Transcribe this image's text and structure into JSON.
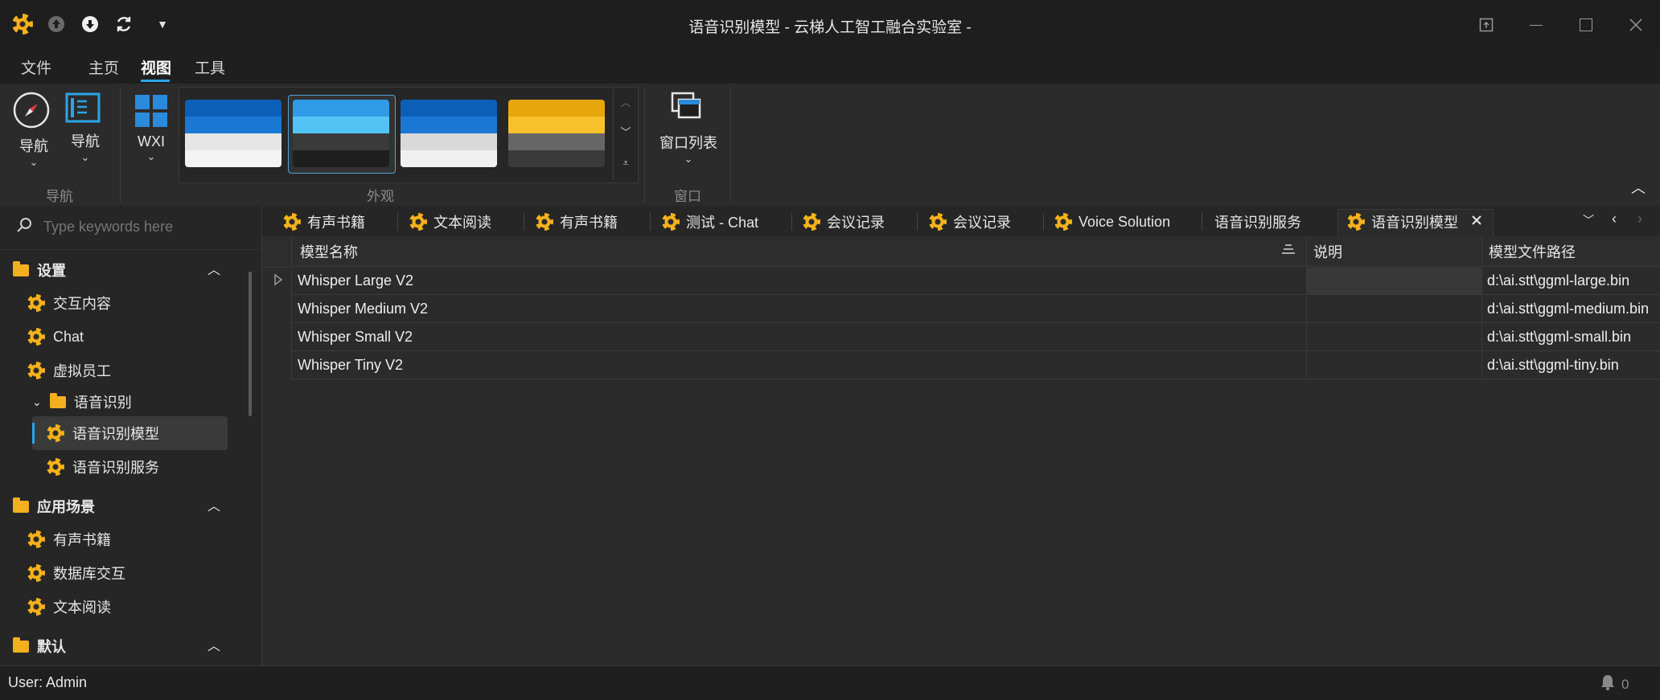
{
  "window": {
    "title": "语音识别模型 - 云梯人工智工融合实验室 -"
  },
  "menu": {
    "tabs": [
      "文件",
      "主页",
      "视图",
      "工具"
    ],
    "active": "视图"
  },
  "ribbon": {
    "nav_button_1": "导航",
    "nav_button_2": "导航",
    "group_nav": "导航",
    "wxi_label": "WXI",
    "group_appearance": "外观",
    "window_list_label": "窗口列表",
    "group_window": "窗口"
  },
  "themes": [
    {
      "colors": [
        "#0b5fb8",
        "#1a78d4",
        "#e6e6e6",
        "#f3f3f3"
      ]
    },
    {
      "colors": [
        "#2f9ae6",
        "#53c2f5",
        "#3a3a3a",
        "#1f1f1f"
      ]
    },
    {
      "colors": [
        "#0b5fb8",
        "#1a78d4",
        "#d9d9d9",
        "#f0f0f0"
      ]
    },
    {
      "colors": [
        "#e8a60d",
        "#f6c12a",
        "#666666",
        "#3a3a3a"
      ]
    }
  ],
  "search": {
    "placeholder": "Type keywords here"
  },
  "sidebar": {
    "settings": {
      "title": "设置",
      "items": [
        "交互内容",
        "Chat",
        "虚拟员工"
      ],
      "subfolder": "语音识别",
      "subitems": [
        "语音识别模型",
        "语音识别服务"
      ]
    },
    "scenarios": {
      "title": "应用场景",
      "items": [
        "有声书籍",
        "数据库交互",
        "文本阅读"
      ]
    },
    "default": {
      "title": "默认"
    }
  },
  "tabs": [
    "有声书籍",
    "文本阅读",
    "有声书籍",
    "测试 - Chat",
    "会议记录",
    "会议记录",
    "Voice Solution",
    "语音识别服务",
    "语音识别模型"
  ],
  "grid": {
    "columns": [
      "模型名称",
      "说明",
      "模型文件路径"
    ],
    "rows": [
      [
        "Whisper Large V2",
        "",
        "d:\\ai.stt\\ggml-large.bin"
      ],
      [
        "Whisper Medium V2",
        "",
        "d:\\ai.stt\\ggml-medium.bin"
      ],
      [
        "Whisper Small V2",
        "",
        "d:\\ai.stt\\ggml-small.bin"
      ],
      [
        "Whisper Tiny V2",
        "",
        "d:\\ai.stt\\ggml-tiny.bin"
      ]
    ]
  },
  "status": {
    "user": "User: Admin",
    "notifications": "0"
  },
  "colors": {
    "accent": "#2aa5e8",
    "gear": "#f6b21b",
    "folder": "#f2b01e"
  }
}
